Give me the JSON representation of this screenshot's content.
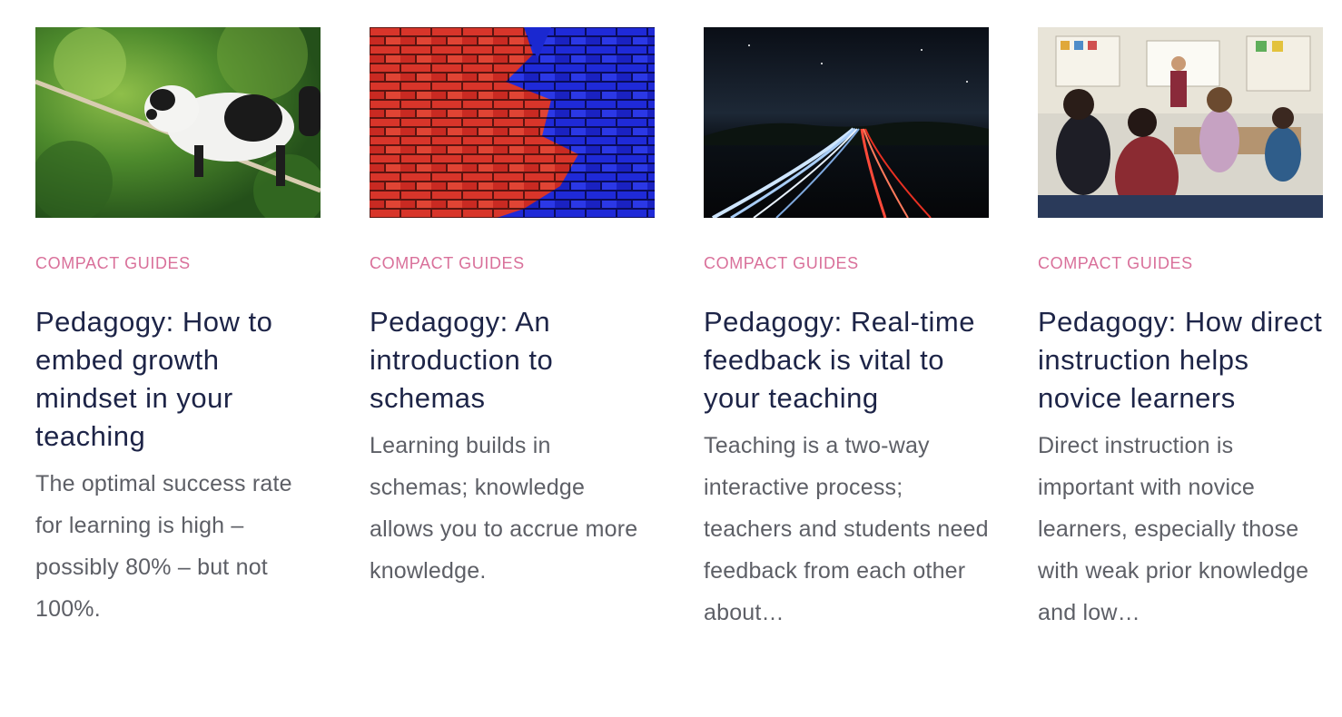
{
  "articles": [
    {
      "image": "lemur-on-rope-photo",
      "category": "COMPACT GUIDES",
      "title": "Pedagogy: How to embed growth mindset in your teaching",
      "excerpt": "The optimal success rate for learning is high – possibly 80% – but not 100%."
    },
    {
      "image": "red-blue-brick-wall-photo",
      "category": "COMPACT GUIDES",
      "title": "Pedagogy: An introduction to schemas",
      "excerpt": "Learning builds in schemas; knowledge allows you to accrue more knowledge."
    },
    {
      "image": "night-highway-light-trails-photo",
      "category": "COMPACT GUIDES",
      "title": "Pedagogy: Real-time feedback is vital to your teaching",
      "excerpt": "Teaching is a two-way interactive process; teachers and students need feedback from each other about…"
    },
    {
      "image": "classroom-photo",
      "category": "COMPACT GUIDES",
      "title": "Pedagogy: How direct instruction helps novice learners",
      "excerpt": "Direct instruction is important with novice learners, especially those with weak prior knowledge and low…"
    }
  ],
  "colors": {
    "category": "#d9709a",
    "title": "#1d2447",
    "excerpt": "#5d5f66"
  }
}
